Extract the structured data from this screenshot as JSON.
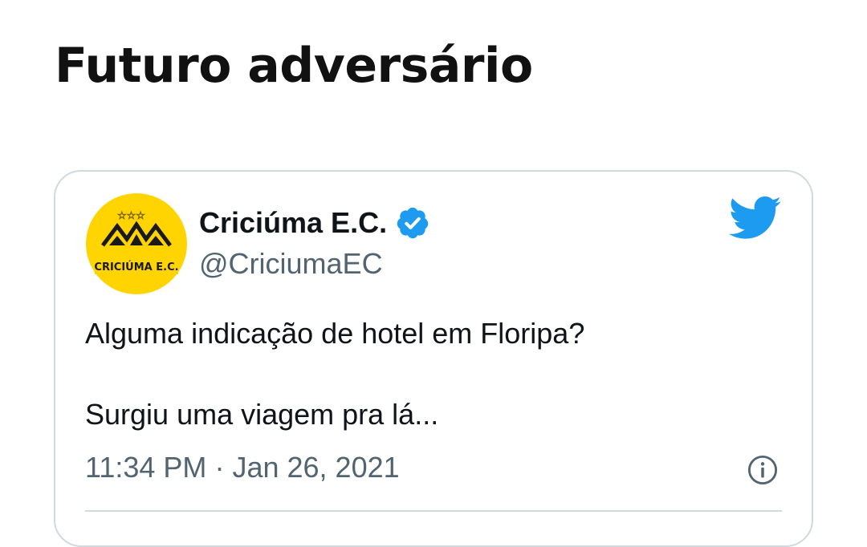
{
  "heading": "Futuro adversário",
  "tweet": {
    "author_name": "Criciúma E.C.",
    "handle": "@CriciumaEC",
    "avatar_text": "CRICIÚMA E.C.",
    "text_lines": [
      "Alguma indicação de hotel em Floripa?",
      "Surgiu uma viagem pra lá..."
    ],
    "time": "11:34 PM",
    "separator": "·",
    "date": "Jan 26, 2021",
    "verified": true
  },
  "colors": {
    "twitter_blue": "#1d9bf0",
    "avatar_yellow": "#ffd400",
    "text_secondary": "#536471",
    "border": "#cfd9de"
  },
  "icons": [
    "verified-badge-icon",
    "twitter-bird-icon",
    "info-icon"
  ]
}
